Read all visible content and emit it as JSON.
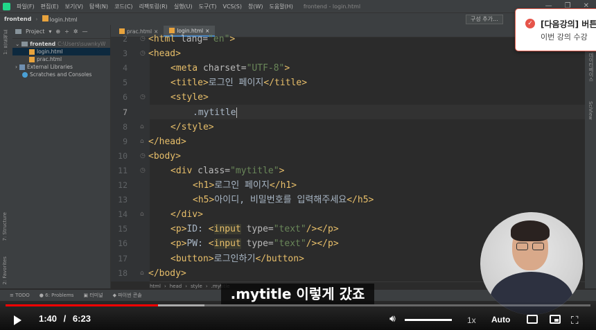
{
  "menubar": {
    "items": [
      "파일(F)",
      "편집(E)",
      "보기(V)",
      "탐색(N)",
      "코드(C)",
      "리팩토링(R)",
      "실행(U)",
      "도구(T)",
      "VCS(S)",
      "창(W)",
      "도움말(H)"
    ],
    "window_title": "frontend - login.html"
  },
  "navbar": {
    "project": "frontend",
    "file": "login.html",
    "run_config": "구성 추가..."
  },
  "left_strip": {
    "project_label": "1: 프로젝트",
    "structure_label": "7: Structure",
    "favorites_label": "2: Favorites"
  },
  "project_panel": {
    "header": "Project",
    "root_name": "frontend",
    "root_path": "C:\\Users\\suwnkyW",
    "files": [
      "login.html",
      "prac.html"
    ],
    "external_libraries": "External Libraries",
    "scratches": "Scratches and Consoles"
  },
  "tabs": [
    {
      "label": "prac.html"
    },
    {
      "label": "login.html"
    }
  ],
  "editor": {
    "lines": [
      {
        "num": "2",
        "code": "<html lang=\"en\">"
      },
      {
        "num": "3",
        "code": "<head>"
      },
      {
        "num": "4",
        "code": "<meta charset=\"UTF-8\">"
      },
      {
        "num": "5",
        "code": "<title>로그인 페이지</title>"
      },
      {
        "num": "6",
        "code": "<style>"
      },
      {
        "num": "7",
        "code": ".mytitle"
      },
      {
        "num": "8",
        "code": "</style>"
      },
      {
        "num": "9",
        "code": "</head>"
      },
      {
        "num": "10",
        "code": "<body>"
      },
      {
        "num": "11",
        "code": "<div class=\"mytitle\">"
      },
      {
        "num": "12",
        "code": "<h1>로그인 페이지</h1>"
      },
      {
        "num": "13",
        "code": "<h5>아이디, 비밀번호를 입력해주세요</h5>"
      },
      {
        "num": "14",
        "code": "</div>"
      },
      {
        "num": "15",
        "code": "<p>ID: <input type=\"text\"/></p>"
      },
      {
        "num": "16",
        "code": "<p>PW: <input type=\"text\"/></p>"
      },
      {
        "num": "17",
        "code": "<button>로그인하기</button>"
      },
      {
        "num": "18",
        "code": "</body>"
      }
    ],
    "breadcrumbs": [
      "html",
      "head",
      "style",
      ".mytitle"
    ]
  },
  "right_strip": {
    "db_label": "데이터베이스",
    "sciview_label": "SciView"
  },
  "bottom_tools": [
    "TODO",
    "6: Problems",
    "터미널",
    "파이썬 콘솔"
  ],
  "video": {
    "current_time": "1:40",
    "time_separator": "/",
    "duration": "6:23",
    "progress": 0.261,
    "buffered": 0.34,
    "volume": 1.0,
    "speed": "1x",
    "quality": "Auto",
    "caption": ".mytitle 이렇게 갔죠"
  },
  "notification": {
    "title": "[다음강의] 버튼",
    "body": "이번 강의 수강"
  },
  "colors": {
    "accent_red": "#ff0000",
    "notif_red": "#e6544a",
    "tag_yellow": "#e8bf6a",
    "string_green": "#6a8759"
  }
}
